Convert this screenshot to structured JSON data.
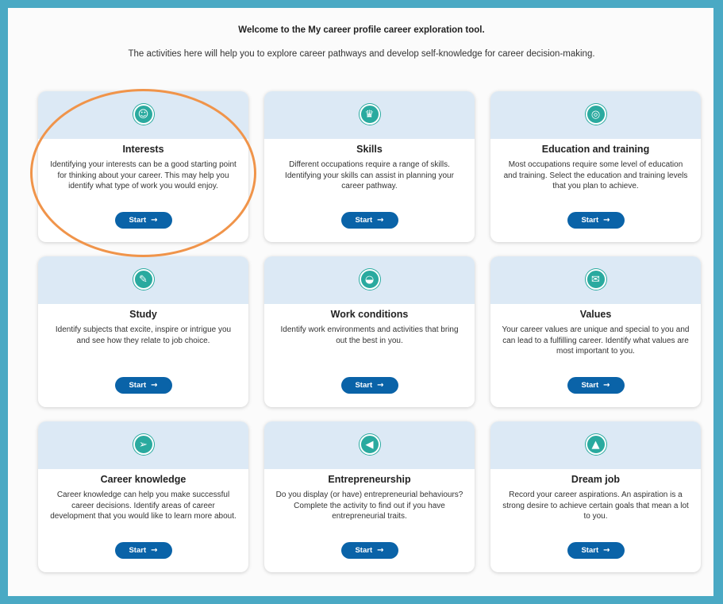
{
  "intro": {
    "title": "Welcome to the My career profile career exploration tool.",
    "subtitle": "The activities here will help you to explore career pathways and develop self-knowledge for career decision-making."
  },
  "colors": {
    "frame": "#4aa9c4",
    "card_header": "#dce9f5",
    "icon": "#2aaa9f",
    "button": "#0a63a8",
    "highlight": "#f0944a"
  },
  "start_label": "Start",
  "arrow_icon": "→",
  "cards": [
    {
      "title": "Interests",
      "desc": "Identifying your interests can be a good starting point for thinking about your career. This may help you identify what type of work you would enjoy.",
      "icon": "person-heart-icon",
      "glyph": "☺"
    },
    {
      "title": "Skills",
      "desc": "Different occupations require a range of skills. Identifying your skills can assist in planning your career pathway.",
      "icon": "trophy-icon",
      "glyph": "♛"
    },
    {
      "title": "Education and training",
      "desc": "Most occupations require some level of education and training. Select the education and training levels that you plan to achieve.",
      "icon": "target-icon",
      "glyph": "◎"
    },
    {
      "title": "Study",
      "desc": "Identify subjects that excite, inspire or intrigue you and see how they relate to job choice.",
      "icon": "pencil-icon",
      "glyph": "✎"
    },
    {
      "title": "Work conditions",
      "desc": "Identify work environments and activities that bring out the best in you.",
      "icon": "sunglasses-icon",
      "glyph": "◒"
    },
    {
      "title": "Values",
      "desc": "Your career values are unique and special to you and can lead to a fulfilling career. Identify what values are most important to you.",
      "icon": "chat-bubble-icon",
      "glyph": "✉"
    },
    {
      "title": "Career knowledge",
      "desc": "Career knowledge can help you make successful career decisions. Identify areas of career development that you would like to learn more about.",
      "icon": "paper-plane-icon",
      "glyph": "➢"
    },
    {
      "title": "Entrepreneurship",
      "desc": "Do you display (or have) entrepreneurial behaviours? Complete the activity to find out if you have entrepreneurial traits.",
      "icon": "megaphone-icon",
      "glyph": "◀"
    },
    {
      "title": "Dream job",
      "desc": "Record your career aspirations. An aspiration is a strong desire to achieve certain goals that mean a lot to you.",
      "icon": "mountain-icon",
      "glyph": "▲"
    }
  ]
}
